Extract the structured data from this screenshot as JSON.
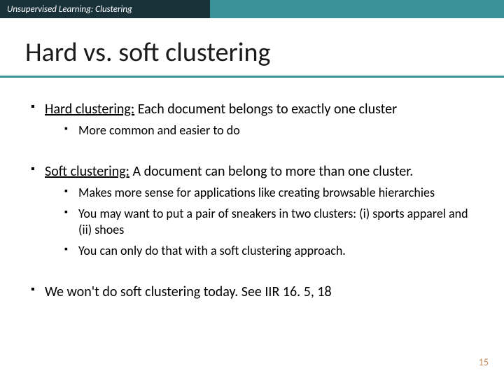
{
  "topbar": {
    "label": "Unsupervised Learning: Clustering"
  },
  "title": "Hard vs. soft clustering",
  "bullets": {
    "b1": {
      "prefix": "Hard clustering:",
      "rest": " Each document belongs to exactly one cluster",
      "sub1": "More common and easier to do"
    },
    "b2": {
      "prefix": "Soft clustering:",
      "rest": " A document can belong to more than one cluster.",
      "sub1": "Makes more sense for applications like creating browsable hierarchies",
      "sub2": "You may want to put a pair of sneakers in two clusters: (i) sports apparel and (ii) shoes",
      "sub3": "You can only do that with a soft clustering approach."
    },
    "b3": {
      "text": "We won't do soft clustering today. See IIR 16. 5,  18"
    }
  },
  "page_number": "15"
}
